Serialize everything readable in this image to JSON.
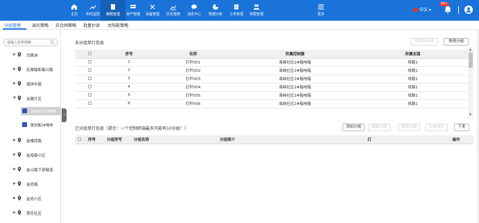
{
  "nav": [
    {
      "label": "主页",
      "icon": "home-icon"
    },
    {
      "label": "实时监控",
      "icon": "monitor-icon"
    },
    {
      "label": "策略管理",
      "icon": "strategy-icon"
    },
    {
      "label": "资产管理",
      "icon": "asset-icon"
    },
    {
      "label": "设备管理",
      "icon": "device-icon"
    },
    {
      "label": "历史报表",
      "icon": "report-icon"
    },
    {
      "label": "消息中心",
      "icon": "message-icon"
    },
    {
      "label": "数据分析",
      "icon": "analysis-icon"
    },
    {
      "label": "工单管理",
      "icon": "workorder-icon"
    },
    {
      "label": "权限管理",
      "icon": "permission-icon"
    },
    {
      "label": "更多",
      "icon": "menu-icon"
    }
  ],
  "header": {
    "language": "中文",
    "badge": "99+"
  },
  "subtabs": [
    "分组管理",
    "调光策略",
    "拉合闸策略",
    "批量抄读",
    "太阳能策略"
  ],
  "sidebar": {
    "search_placeholder": "请输入名称搜索",
    "items": [
      "白猫洲",
      "宏泰路和泰兴路",
      "湖滨中路",
      "会展片区",
      "金楼西路",
      "金海泰小区",
      "金山路下穿隧道",
      "金尚路",
      "金尚小区",
      "莲花社区"
    ],
    "children": [
      "海峡社区2#箱电",
      "展览路1#箱电"
    ]
  },
  "unassigned": {
    "title": "未分组单灯信息",
    "buttons": {
      "add": "添加到分组",
      "quick": "快速分组"
    },
    "headers": [
      "序号",
      "名称",
      "所属控制器",
      "所属支路"
    ],
    "rows": [
      [
        "1",
        "灯杆001",
        "海峡社区2#箱电箱",
        "线路1"
      ],
      [
        "2",
        "灯杆002",
        "海峡社区2#箱电箱",
        "线路1"
      ],
      [
        "3",
        "灯杆003",
        "海峡社区2#箱电箱",
        "线路1"
      ],
      [
        "4",
        "灯杆004",
        "海峡社区2#箱电箱",
        "线路1"
      ],
      [
        "5",
        "灯杆005",
        "海峡社区2#箱电箱",
        "线路1"
      ],
      [
        "6",
        "灯杆006",
        "海峡社区2#箱电箱",
        "线路1"
      ]
    ]
  },
  "grouped": {
    "title": "已分组单灯信息（提示：一个控制终端最多只能有10分组！）",
    "buttons": {
      "add": "添加分组",
      "edit": "编辑分组",
      "delete": "删除分组",
      "call": "分组调光",
      "issue": "下发"
    },
    "headers": [
      "序号",
      "分组序号",
      "分组名称",
      "分组简介",
      "灯",
      "操作"
    ]
  }
}
